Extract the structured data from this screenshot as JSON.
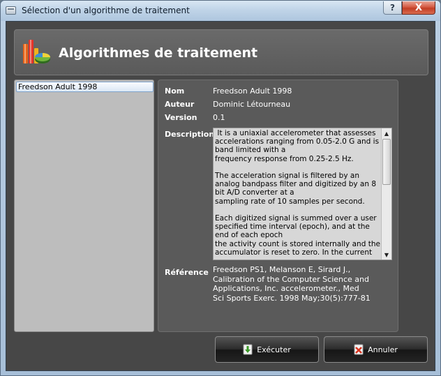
{
  "window": {
    "title": "Sélection d'un algorithme de traitement",
    "help_label": "?",
    "close_label": "X"
  },
  "header": {
    "title": "Algorithmes de traitement",
    "icon": "chart-icon"
  },
  "algorithm_list": {
    "items": [
      {
        "label": "Freedson Adult 1998",
        "selected": true
      }
    ]
  },
  "details": {
    "name_label": "Nom",
    "name_value": "Freedson Adult 1998",
    "author_label": "Auteur",
    "author_value": "Dominic Létourneau",
    "version_label": "Version",
    "version_value": "0.1",
    "description_label": "Description",
    "description_value": " It is a uniaxial accelerometer that assesses accelerations ranging from 0.05-2.0 G and is band limited with a\nfrequency response from 0.25-2.5 Hz.\n\nThe acceleration signal is filtered by an analog bandpass filter and digitized by an 8 bit A/D converter at a\nsampling rate of 10 samples per second.\n\nEach digitized signal is summed over a user specified time interval (epoch), and at the end of each epoch\nthe activity count is stored internally and the accumulator is reset to zero. In the current",
    "reference_label": "Référence",
    "reference_value": "Freedson PS1, Melanson E, Sirard J.,\nCalibration of the Computer Science and\nApplications, Inc. accelerometer., Med\nSci Sports Exerc. 1998 May;30(5):777-81"
  },
  "buttons": {
    "run_label": "Exécuter",
    "run_icon": "download-arrow-icon",
    "cancel_label": "Annuler",
    "cancel_icon": "cancel-document-icon"
  }
}
